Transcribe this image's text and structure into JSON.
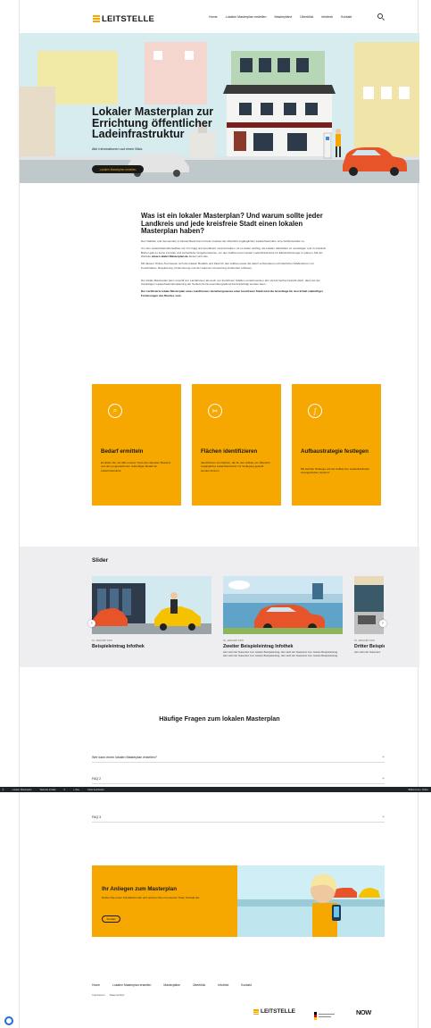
{
  "header": {
    "logo_text": "LEITSTELLE",
    "nav": [
      "Home",
      "Lokalen Masterplan erstellen",
      "Masterpläne",
      "Überblick",
      "Infothek",
      "Kontakt"
    ],
    "search_icon": "search-icon"
  },
  "hero": {
    "title": "Lokaler Masterplan zur Errichtung öffentlicher Ladeinfrastruktur",
    "subtitle": "Alle Informationen auf einen Blick.",
    "button": "Lokalen Masterplan erstellen"
  },
  "intro": {
    "title": "Was ist ein lokaler Masterplan? Und warum sollte jeder Landkreis und jede kreisfreie Stadt einen lokalen Masterplan haben?",
    "p1": "Den Städten und Gemeinden in Deutschland kommt beim Ausbau der öffentlich zugänglichen Ladeinfrastruktur eine Schlüsselrolle zu.",
    "p2a": "Um den Ladeinfrastrukturaufbau vor Ort zügig und koordiniert voranzutreiben, ist es daher wichtig, die lokalen Aktivitäten zu verstetigen und zu bündeln. Bisher gab es keine zentrale und einheitliche Vorgehensweise, um den Aufbau kommunaler Ladeinfrastruktur für Elektrofahrzeuge zu planen. Mit der Website",
    "p2link": "www.Lokaler-Masterplan.de",
    "p2b": "ändert sich das.",
    "p3": "Mit diesem Online-Tool lassen sich die lokalen Bedarfe und Ziele für den Aufbau sowie die damit verbundenen erforderlichen Maßnahmen zur Koordination, Regulierung, Finanzierung und der weiteren Umsetzung strukturiert erfassen.",
    "p4": "Der lokale Masterplan kann sowohl von Landkreisen als auch von kreisfreien Städten erstellt werden. Ein Vorteil hierbei besteht darin, dass bei der zukünftigen Ladeinfrastrukturplanung der Verkehr kommunenübergreifend berücksichtigt werden kann.",
    "p5": "Der zertifizierte lokale Masterplan eines Landkreises beziehungsweise einer kreisfreien Stadt wird die Grundlage für den Erhalt zukünftiger Förderungen des Bundes sein."
  },
  "cards": [
    {
      "icon": "chart-search-icon",
      "title": "Bedarf ermitteln",
      "text": "Ermitteln Sie mit Hilfe unserer Tools den aktuellen Bestand und den prognostizierten zukünftigen Bedarf an Ladeinfrastruktur."
    },
    {
      "icon": "tools-icon",
      "title": "Flächen identifizieren",
      "text": "Identifizieren sie Flächen, die für den Aufbau von öffentlich zugänglicher Ladeinfrastruktur zur Verfügung gestellt werden können."
    },
    {
      "icon": "strategy-icon",
      "title": "Aufbaustrategie festlegen",
      "text": "Mit welcher Strategie soll der Aufbau der Ladeinfrastruktur vorangetrieben werden?"
    }
  ],
  "slider": {
    "title": "Slider",
    "slides": [
      {
        "date": "01. JANUARY 1970",
        "title": "Beispieleintrag Infothek",
        "text": ""
      },
      {
        "date": "01. JANUARY 1970",
        "title": "Zweiter Beispieleintrag Infothek",
        "text": "Hier steht der Teasertext zum zweiten Beispieleintrag. Hier steht der Teasertext zum zweiten Beispieleintrag. Hier steht der Teasertext zum zweiten Beispieleintrag. Hier steht der Teasertext zum zweiten Beispieleintrag."
      },
      {
        "date": "01. JANUARY 1970",
        "title": "Dritter Beispieleintrag",
        "text": "Hier steht der Teasertext"
      }
    ],
    "prev": "‹",
    "next": "›"
  },
  "faq": {
    "title": "Häufige Fragen zum lokalen Masterplan",
    "items": [
      "Wer kann einen lokalen Masterplan erstellen?",
      "FAQ 2",
      "FAQ 3"
    ]
  },
  "adminbar": {
    "items": [
      "Lokaler Masterplan",
      "Website-Inhalte",
      "0",
      "+ Neu",
      "Seite bearbeiten"
    ],
    "user": "Willkommen, Volker"
  },
  "cta": {
    "title": "Ihr Anliegen zum Masterplan",
    "text": "Nutzen Sie unser Kontaktformular und nehmen Sie mit unserem Team Kontakt auf.",
    "button": "Kontakt"
  },
  "footer": {
    "nav": [
      "Home",
      "Lokalen Masterplan erstellen",
      "Masterpläne",
      "Überblick",
      "Infothek",
      "Kontakt"
    ],
    "legal": [
      "Impressum",
      "Datenschutz"
    ],
    "logos": [
      "LEITSTELLE",
      "NOW"
    ]
  },
  "colors": {
    "accent": "#f6a800",
    "dark": "#1a1a1a",
    "slider_bg": "#eeeef0"
  }
}
